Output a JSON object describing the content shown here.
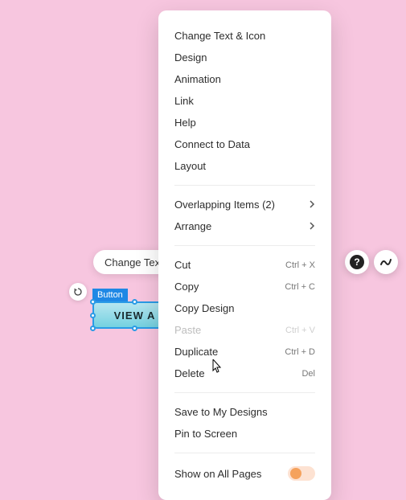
{
  "toolbar": {
    "change_text": "Change Tex"
  },
  "selection": {
    "label": "Button",
    "button_text": "VIEW A"
  },
  "menu": {
    "group1": [
      "Change Text & Icon",
      "Design",
      "Animation",
      "Link",
      "Help",
      "Connect to Data",
      "Layout"
    ],
    "overlapping": {
      "label": "Overlapping Items (2)"
    },
    "arrange": {
      "label": "Arrange"
    },
    "cut": {
      "label": "Cut",
      "shortcut": "Ctrl + X"
    },
    "copy": {
      "label": "Copy",
      "shortcut": "Ctrl + C"
    },
    "copy_design": {
      "label": "Copy Design"
    },
    "paste": {
      "label": "Paste",
      "shortcut": "Ctrl + V"
    },
    "duplicate": {
      "label": "Duplicate",
      "shortcut": "Ctrl + D"
    },
    "delete": {
      "label": "Delete",
      "shortcut": "Del"
    },
    "save_designs": {
      "label": "Save to My Designs"
    },
    "pin": {
      "label": "Pin to Screen"
    },
    "show_all": {
      "label": "Show on All Pages"
    }
  }
}
